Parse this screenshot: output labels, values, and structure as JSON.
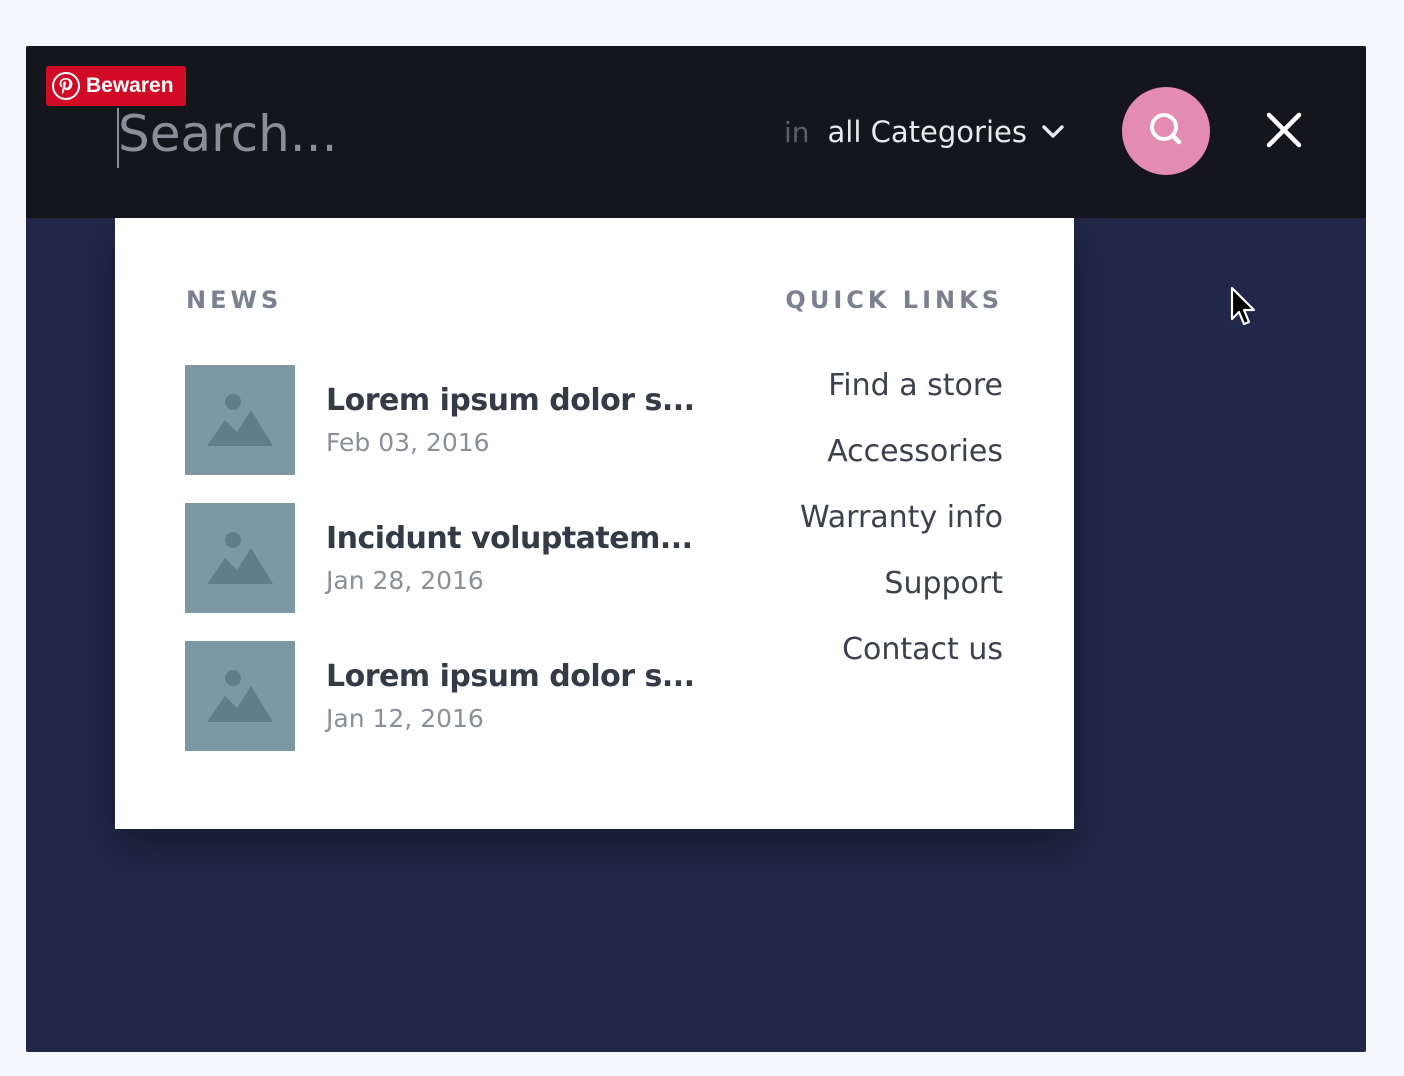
{
  "pinterest": {
    "save_label": "Bewaren"
  },
  "search": {
    "placeholder": "Search...",
    "in_label": "in",
    "category_value": "all Categories"
  },
  "dropdown": {
    "news": {
      "title": "NEWS",
      "items": [
        {
          "headline": "Lorem ipsum dolor s...",
          "date": "Feb 03, 2016"
        },
        {
          "headline": "Incidunt voluptatem...",
          "date": "Jan 28, 2016"
        },
        {
          "headline": "Lorem ipsum dolor s...",
          "date": "Jan 12, 2016"
        }
      ]
    },
    "quick_links": {
      "title": "QUICK LINKS",
      "items": [
        "Find a store",
        "Accessories",
        "Warranty info",
        "Support",
        "Contact us"
      ]
    }
  },
  "colors": {
    "page_bg": "#f5f7fc",
    "search_bar_bg": "#14161c",
    "content_bg": "#212748",
    "search_button": "#e48bb1",
    "pinterest_red": "#d10a25",
    "thumb": "#7c98a3"
  },
  "icons": {
    "pinterest": "pinterest-icon",
    "chevron": "chevron-down-icon",
    "search": "search-icon",
    "close": "close-icon",
    "thumbnail": "image-placeholder-icon",
    "pointer": "mouse-pointer-icon"
  }
}
